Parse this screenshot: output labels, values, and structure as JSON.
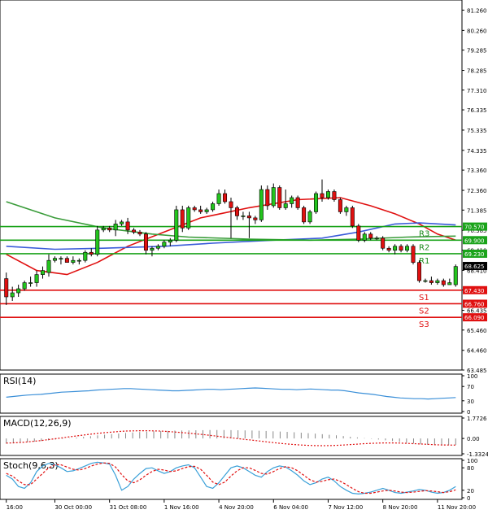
{
  "chart_data": {
    "type": "candlestick",
    "price_axis": {
      "ticks": [
        "81.260",
        "80.260",
        "79.285",
        "78.285",
        "77.310",
        "76.335",
        "75.335",
        "74.335",
        "73.360",
        "72.360",
        "71.385",
        "70.385",
        "69.410",
        "68.410",
        "67.435",
        "66.435",
        "65.460",
        "64.460",
        "63.485"
      ],
      "tick_values": [
        81.26,
        80.26,
        79.285,
        78.285,
        77.31,
        76.335,
        75.335,
        74.335,
        73.36,
        72.36,
        71.385,
        70.385,
        69.41,
        68.41,
        67.435,
        66.435,
        65.46,
        64.46,
        63.485
      ],
      "range": [
        63.485,
        81.76
      ],
      "current_price": "68.625",
      "current_value": 68.625
    },
    "x_axis": {
      "labels": [
        "16:00",
        "30 Oct 00:00",
        "31 Oct 08:00",
        "1 Nov 16:00",
        "4 Nov 20:00",
        "6 Nov 04:00",
        "7 Nov 12:00",
        "8 Nov 20:00",
        "11 Nov 20:00"
      ],
      "label_bar_index": [
        0,
        8,
        17,
        26,
        35,
        44,
        53,
        62,
        71
      ],
      "bar_count": 75
    },
    "candles": [
      {
        "o": 68.0,
        "h": 68.3,
        "l": 66.7,
        "c": 67.1
      },
      {
        "o": 67.1,
        "h": 67.6,
        "l": 66.9,
        "c": 67.3
      },
      {
        "o": 67.3,
        "h": 67.7,
        "l": 67.1,
        "c": 67.5
      },
      {
        "o": 67.5,
        "h": 67.9,
        "l": 67.4,
        "c": 67.8
      },
      {
        "o": 67.8,
        "h": 68.1,
        "l": 67.6,
        "c": 67.8
      },
      {
        "o": 67.8,
        "h": 68.4,
        "l": 67.6,
        "c": 68.2
      },
      {
        "o": 68.2,
        "h": 68.6,
        "l": 68.0,
        "c": 68.4
      },
      {
        "o": 68.3,
        "h": 69.2,
        "l": 68.1,
        "c": 68.9
      },
      {
        "o": 68.9,
        "h": 69.1,
        "l": 68.8,
        "c": 69.0
      },
      {
        "o": 69.0,
        "h": 69.1,
        "l": 68.7,
        "c": 69.0
      },
      {
        "o": 69.0,
        "h": 69.1,
        "l": 68.8,
        "c": 68.8
      },
      {
        "o": 68.8,
        "h": 69.1,
        "l": 68.7,
        "c": 68.9
      },
      {
        "o": 68.9,
        "h": 69.0,
        "l": 68.7,
        "c": 68.9
      },
      {
        "o": 68.9,
        "h": 69.4,
        "l": 68.8,
        "c": 69.3
      },
      {
        "o": 69.3,
        "h": 69.5,
        "l": 69.1,
        "c": 69.2
      },
      {
        "o": 69.2,
        "h": 70.6,
        "l": 69.1,
        "c": 70.4
      },
      {
        "o": 70.4,
        "h": 70.6,
        "l": 70.3,
        "c": 70.5
      },
      {
        "o": 70.5,
        "h": 70.6,
        "l": 70.3,
        "c": 70.4
      },
      {
        "o": 70.4,
        "h": 70.9,
        "l": 70.1,
        "c": 70.7
      },
      {
        "o": 70.7,
        "h": 70.9,
        "l": 70.6,
        "c": 70.8
      },
      {
        "o": 70.8,
        "h": 71.0,
        "l": 70.2,
        "c": 70.4
      },
      {
        "o": 70.4,
        "h": 70.5,
        "l": 70.2,
        "c": 70.3
      },
      {
        "o": 70.3,
        "h": 70.4,
        "l": 70.1,
        "c": 70.2
      },
      {
        "o": 70.2,
        "h": 70.3,
        "l": 69.2,
        "c": 69.4
      },
      {
        "o": 69.4,
        "h": 69.6,
        "l": 69.1,
        "c": 69.5
      },
      {
        "o": 69.5,
        "h": 69.7,
        "l": 69.4,
        "c": 69.6
      },
      {
        "o": 69.6,
        "h": 69.9,
        "l": 69.5,
        "c": 69.8
      },
      {
        "o": 69.8,
        "h": 70.0,
        "l": 69.6,
        "c": 69.9
      },
      {
        "o": 69.9,
        "h": 71.6,
        "l": 69.8,
        "c": 71.4
      },
      {
        "o": 71.4,
        "h": 71.6,
        "l": 70.3,
        "c": 70.5
      },
      {
        "o": 70.5,
        "h": 71.6,
        "l": 70.4,
        "c": 71.5
      },
      {
        "o": 71.5,
        "h": 71.6,
        "l": 71.3,
        "c": 71.4
      },
      {
        "o": 71.4,
        "h": 71.6,
        "l": 71.2,
        "c": 71.3
      },
      {
        "o": 71.3,
        "h": 71.5,
        "l": 71.2,
        "c": 71.4
      },
      {
        "o": 71.4,
        "h": 71.8,
        "l": 71.3,
        "c": 71.7
      },
      {
        "o": 71.7,
        "h": 72.4,
        "l": 71.6,
        "c": 72.2
      },
      {
        "o": 72.2,
        "h": 72.4,
        "l": 71.7,
        "c": 71.8
      },
      {
        "o": 71.8,
        "h": 72.0,
        "l": 70.0,
        "c": 71.5
      },
      {
        "o": 71.5,
        "h": 71.6,
        "l": 70.9,
        "c": 71.1
      },
      {
        "o": 71.1,
        "h": 71.3,
        "l": 70.9,
        "c": 71.1
      },
      {
        "o": 71.1,
        "h": 71.3,
        "l": 70.0,
        "c": 71.0
      },
      {
        "o": 71.0,
        "h": 71.1,
        "l": 70.7,
        "c": 70.9
      },
      {
        "o": 70.9,
        "h": 72.6,
        "l": 70.8,
        "c": 72.4
      },
      {
        "o": 72.4,
        "h": 72.6,
        "l": 71.4,
        "c": 71.6
      },
      {
        "o": 71.6,
        "h": 72.7,
        "l": 71.5,
        "c": 72.5
      },
      {
        "o": 72.5,
        "h": 72.6,
        "l": 71.4,
        "c": 71.5
      },
      {
        "o": 71.5,
        "h": 72.4,
        "l": 71.4,
        "c": 71.7
      },
      {
        "o": 71.7,
        "h": 72.1,
        "l": 71.5,
        "c": 72.0
      },
      {
        "o": 72.0,
        "h": 72.1,
        "l": 71.4,
        "c": 71.5
      },
      {
        "o": 71.5,
        "h": 71.6,
        "l": 70.7,
        "c": 70.8
      },
      {
        "o": 70.8,
        "h": 71.4,
        "l": 70.7,
        "c": 71.3
      },
      {
        "o": 71.3,
        "h": 72.3,
        "l": 71.2,
        "c": 72.2
      },
      {
        "o": 72.2,
        "h": 72.9,
        "l": 71.8,
        "c": 72.0
      },
      {
        "o": 72.0,
        "h": 72.4,
        "l": 71.9,
        "c": 72.3
      },
      {
        "o": 72.3,
        "h": 72.4,
        "l": 71.8,
        "c": 71.9
      },
      {
        "o": 71.9,
        "h": 72.0,
        "l": 71.2,
        "c": 71.3
      },
      {
        "o": 71.3,
        "h": 71.6,
        "l": 71.1,
        "c": 71.5
      },
      {
        "o": 71.5,
        "h": 71.6,
        "l": 70.5,
        "c": 70.6
      },
      {
        "o": 70.6,
        "h": 70.7,
        "l": 69.8,
        "c": 69.9
      },
      {
        "o": 69.9,
        "h": 70.3,
        "l": 69.8,
        "c": 70.2
      },
      {
        "o": 70.2,
        "h": 70.3,
        "l": 69.9,
        "c": 70.0
      },
      {
        "o": 70.0,
        "h": 70.1,
        "l": 69.9,
        "c": 70.0
      },
      {
        "o": 70.0,
        "h": 70.1,
        "l": 69.4,
        "c": 69.5
      },
      {
        "o": 69.5,
        "h": 69.6,
        "l": 69.3,
        "c": 69.4
      },
      {
        "o": 69.4,
        "h": 69.7,
        "l": 69.2,
        "c": 69.6
      },
      {
        "o": 69.6,
        "h": 69.7,
        "l": 69.3,
        "c": 69.4
      },
      {
        "o": 69.4,
        "h": 69.7,
        "l": 69.3,
        "c": 69.6
      },
      {
        "o": 69.6,
        "h": 69.7,
        "l": 68.7,
        "c": 68.8
      },
      {
        "o": 68.8,
        "h": 68.9,
        "l": 67.8,
        "c": 67.9
      },
      {
        "o": 67.9,
        "h": 68.0,
        "l": 67.8,
        "c": 67.9
      },
      {
        "o": 67.9,
        "h": 68.1,
        "l": 67.7,
        "c": 67.8
      },
      {
        "o": 67.8,
        "h": 68.0,
        "l": 67.7,
        "c": 67.9
      },
      {
        "o": 67.9,
        "h": 68.0,
        "l": 67.6,
        "c": 67.7
      },
      {
        "o": 67.7,
        "h": 68.0,
        "l": 67.7,
        "c": 67.8
      },
      {
        "o": 67.7,
        "h": 68.7,
        "l": 67.6,
        "c": 68.6
      }
    ],
    "moving_averages": [
      {
        "color": "#e01010",
        "points": [
          [
            0,
            69.2
          ],
          [
            5,
            68.4
          ],
          [
            10,
            68.2
          ],
          [
            15,
            68.8
          ],
          [
            20,
            69.6
          ],
          [
            26,
            70.3
          ],
          [
            32,
            71.0
          ],
          [
            40,
            71.5
          ],
          [
            48,
            71.9
          ],
          [
            55,
            72.0
          ],
          [
            60,
            71.6
          ],
          [
            64,
            71.2
          ],
          [
            68,
            70.7
          ],
          [
            71,
            70.2
          ],
          [
            74,
            69.9
          ]
        ]
      },
      {
        "color": "#3a5bd9",
        "points": [
          [
            0,
            69.6
          ],
          [
            8,
            69.45
          ],
          [
            16,
            69.5
          ],
          [
            26,
            69.6
          ],
          [
            34,
            69.75
          ],
          [
            44,
            69.9
          ],
          [
            52,
            70.0
          ],
          [
            58,
            70.3
          ],
          [
            64,
            70.7
          ],
          [
            68,
            70.75
          ],
          [
            74,
            70.65
          ]
        ]
      },
      {
        "color": "#3a9c3a",
        "points": [
          [
            0,
            71.8
          ],
          [
            8,
            71.0
          ],
          [
            16,
            70.5
          ],
          [
            24,
            70.2
          ],
          [
            30,
            70.05
          ],
          [
            40,
            69.95
          ],
          [
            50,
            69.9
          ],
          [
            58,
            69.95
          ],
          [
            66,
            70.05
          ],
          [
            74,
            70.1
          ]
        ]
      }
    ],
    "pivot_levels": [
      {
        "name": "R3",
        "value": 70.57,
        "tag": "70.570",
        "color": "#1aa31a"
      },
      {
        "name": "R2",
        "value": 69.9,
        "tag": "69.900",
        "color": "#1aa31a"
      },
      {
        "name": "R1",
        "value": 69.23,
        "tag": "69.230",
        "color": "#1aa31a"
      },
      {
        "name": "S1",
        "value": 67.43,
        "tag": "67.430",
        "color": "#e01010"
      },
      {
        "name": "S2",
        "value": 66.76,
        "tag": "66.760",
        "color": "#e01010"
      },
      {
        "name": "S3",
        "value": 66.09,
        "tag": "66.090",
        "color": "#e01010"
      }
    ],
    "rsi": {
      "title": "RSI(14)",
      "ticks": [
        "100",
        "70",
        "30",
        "0"
      ],
      "tick_values": [
        100,
        70,
        30,
        0
      ],
      "range": [
        0,
        100
      ],
      "values": [
        40,
        42,
        44,
        46,
        47,
        48,
        50,
        52,
        54,
        55,
        56,
        57,
        58,
        60,
        61,
        62,
        63,
        64,
        64,
        63,
        62,
        61,
        60,
        59,
        58,
        58,
        59,
        60,
        61,
        62,
        62,
        61,
        62,
        63,
        64,
        65,
        66,
        65,
        64,
        63,
        62,
        62,
        61,
        62,
        63,
        62,
        61,
        60,
        60,
        58,
        55,
        52,
        50,
        48,
        45,
        42,
        40,
        38,
        37,
        36,
        36,
        35,
        36,
        37,
        38,
        39
      ]
    },
    "macd": {
      "title": "MACD(12,26,9)",
      "ticks": [
        "1.7726",
        "0.00",
        "-1.3324"
      ],
      "tick_values": [
        1.7726,
        0,
        -1.3324
      ],
      "range": [
        -1.3324,
        1.7726
      ],
      "histogram": [
        -0.45,
        -0.42,
        -0.38,
        -0.33,
        -0.28,
        -0.22,
        -0.16,
        -0.1,
        -0.04,
        0.02,
        0.08,
        0.14,
        0.2,
        0.27,
        0.33,
        0.38,
        0.43,
        0.48,
        0.52,
        0.56,
        0.59,
        0.62,
        0.64,
        0.66,
        0.68,
        0.69,
        0.7,
        0.71,
        0.72,
        0.73,
        0.73,
        0.73,
        0.72,
        0.71,
        0.7,
        0.69,
        0.67,
        0.65,
        0.62,
        0.6,
        0.57,
        0.54,
        0.5,
        0.46,
        0.42,
        0.37,
        0.32,
        0.27,
        0.21,
        0.15,
        0.09,
        0.03,
        -0.03,
        -0.09,
        -0.16,
        -0.23,
        -0.3,
        -0.37,
        -0.44,
        -0.5,
        -0.55,
        -0.58,
        -0.6,
        -0.59,
        -0.56
      ],
      "signal": [
        -0.4,
        -0.38,
        -0.35,
        -0.3,
        -0.24,
        -0.18,
        -0.1,
        -0.02,
        0.06,
        0.14,
        0.22,
        0.3,
        0.37,
        0.44,
        0.5,
        0.55,
        0.6,
        0.64,
        0.66,
        0.67,
        0.67,
        0.66,
        0.64,
        0.6,
        0.56,
        0.51,
        0.46,
        0.4,
        0.34,
        0.27,
        0.2,
        0.13,
        0.06,
        -0.01,
        -0.08,
        -0.15,
        -0.22,
        -0.29,
        -0.36,
        -0.42,
        -0.48,
        -0.53,
        -0.57,
        -0.6,
        -0.62,
        -0.63,
        -0.62,
        -0.6,
        -0.57,
        -0.53,
        -0.49,
        -0.45,
        -0.42,
        -0.4,
        -0.39,
        -0.39,
        -0.4,
        -0.42,
        -0.45,
        -0.48,
        -0.51,
        -0.54,
        -0.56,
        -0.57,
        -0.58
      ]
    },
    "stoch": {
      "title": "Stoch(9,6,3)",
      "ticks": [
        "100",
        "80",
        "20",
        "0"
      ],
      "tick_values": [
        100,
        80,
        20,
        0
      ],
      "range": [
        0,
        100
      ],
      "main_color": "#3aa0d8",
      "signal_color": "#e01010",
      "main": [
        60,
        50,
        30,
        25,
        40,
        70,
        85,
        92,
        88,
        80,
        70,
        72,
        78,
        85,
        92,
        95,
        93,
        90,
        60,
        20,
        30,
        50,
        65,
        78,
        80,
        72,
        65,
        70,
        80,
        85,
        88,
        80,
        55,
        30,
        25,
        40,
        60,
        80,
        85,
        80,
        70,
        60,
        55,
        70,
        80,
        85,
        82,
        72,
        60,
        45,
        35,
        40,
        50,
        55,
        45,
        30,
        20,
        12,
        10,
        12,
        15,
        20,
        25,
        20,
        14,
        12,
        15,
        18,
        22,
        20,
        15,
        12,
        14,
        20,
        30
      ],
      "signal": [
        65,
        58,
        45,
        35,
        35,
        50,
        65,
        80,
        88,
        88,
        82,
        76,
        74,
        78,
        85,
        90,
        93,
        92,
        82,
        62,
        45,
        40,
        48,
        60,
        70,
        76,
        74,
        70,
        72,
        78,
        83,
        84,
        76,
        60,
        42,
        35,
        42,
        58,
        72,
        80,
        80,
        73,
        65,
        63,
        70,
        78,
        83,
        80,
        72,
        60,
        48,
        42,
        44,
        48,
        50,
        44,
        35,
        25,
        16,
        12,
        12,
        15,
        18,
        20,
        18,
        15,
        14,
        15,
        17,
        19,
        18,
        16,
        14,
        16,
        21
      ]
    }
  }
}
